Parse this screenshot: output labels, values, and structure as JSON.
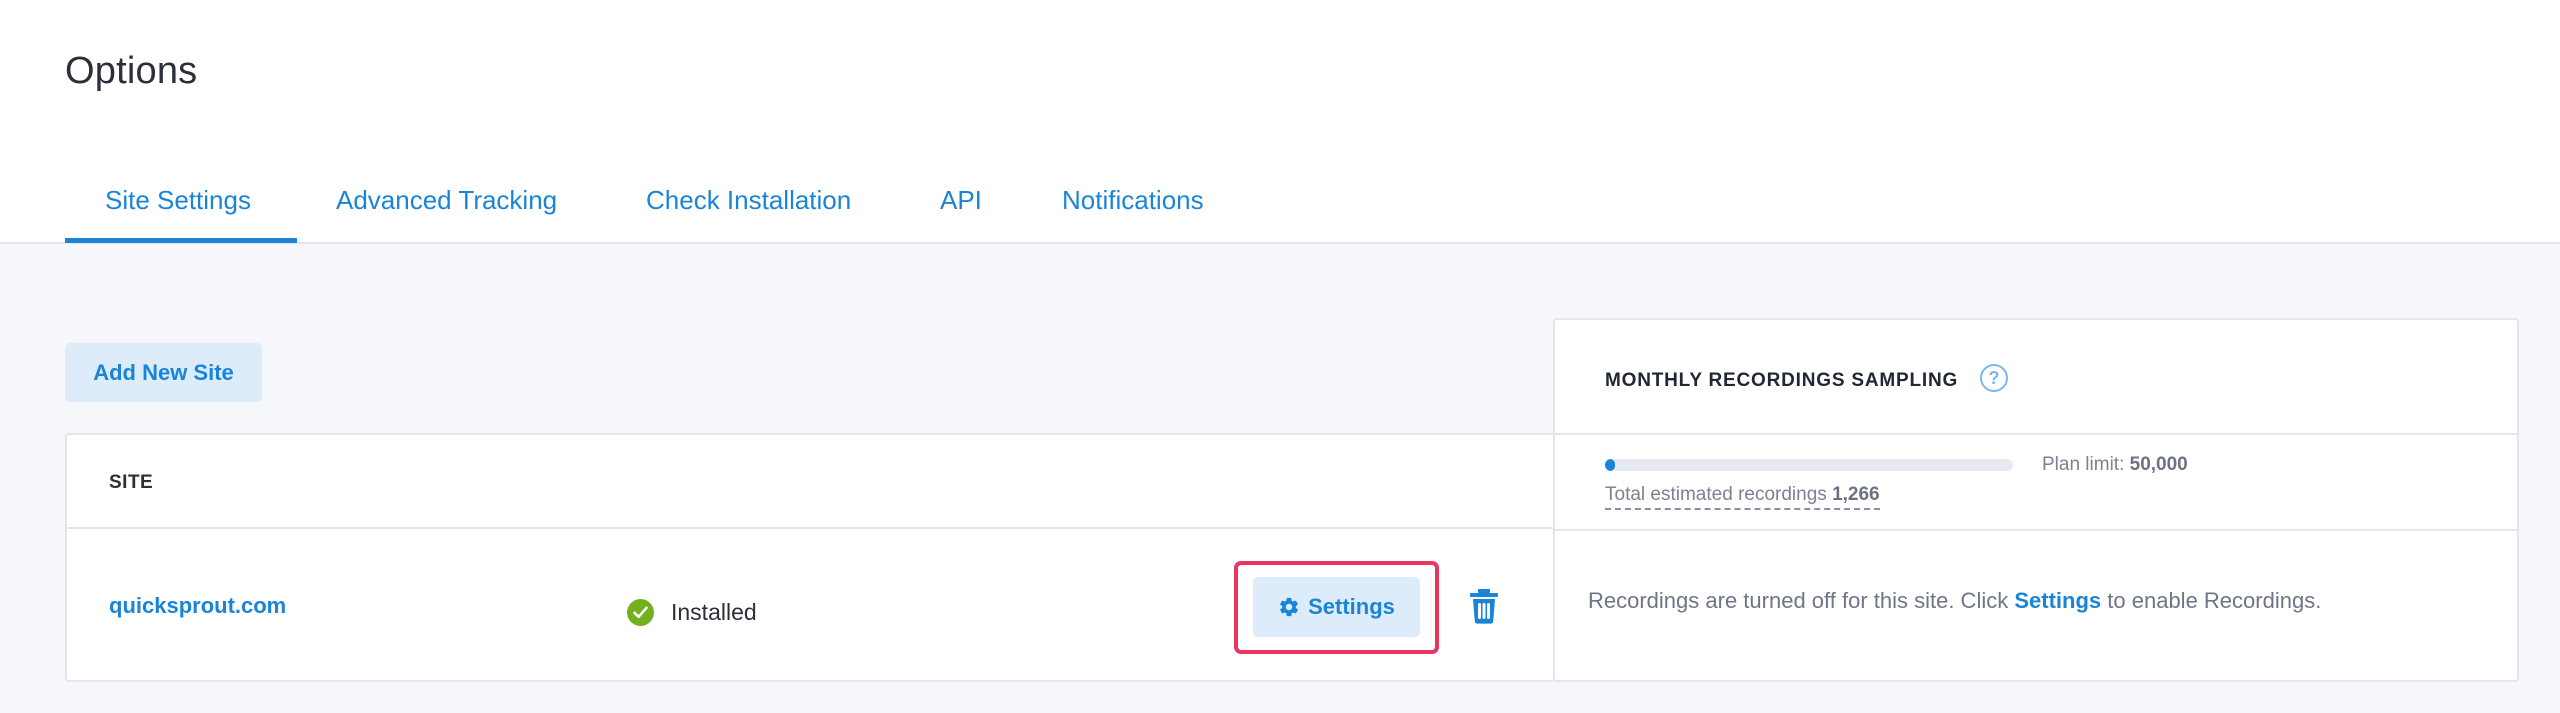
{
  "page": {
    "title": "Options"
  },
  "tabs": [
    {
      "label": "Site Settings",
      "active": true
    },
    {
      "label": "Advanced Tracking",
      "active": false
    },
    {
      "label": "Check Installation",
      "active": false
    },
    {
      "label": "API",
      "active": false
    },
    {
      "label": "Notifications",
      "active": false
    }
  ],
  "actions": {
    "add_site_label": "Add New Site"
  },
  "table": {
    "header": {
      "site": "SITE"
    },
    "rows": [
      {
        "site": "quicksprout.com",
        "status": "Installed",
        "settings_label": "Settings"
      }
    ]
  },
  "sampling": {
    "title": "MONTHLY RECORDINGS SAMPLING",
    "help_icon": "?",
    "plan_limit_label": "Plan limit:",
    "plan_limit_value": "50,000",
    "total_label": "Total estimated recordings",
    "total_value": "1,266",
    "progress_fraction": 0.025,
    "message_before": "Recordings are turned off for this site. Click",
    "message_link": "Settings",
    "message_after": "to enable Recordings."
  },
  "colors": {
    "accent": "#1a84d8",
    "highlight": "#e8365d",
    "success": "#72b01d",
    "background": "#f6f7fb"
  }
}
